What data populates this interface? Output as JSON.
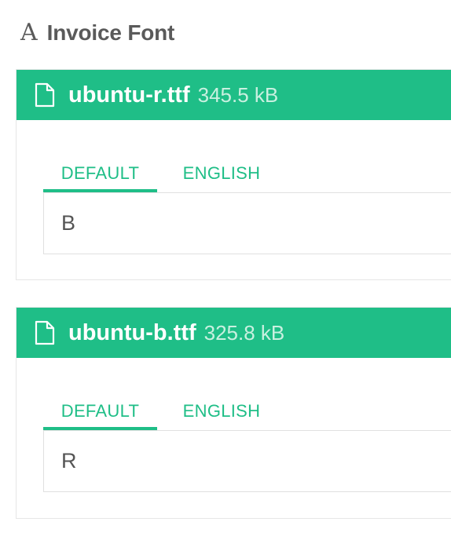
{
  "section": {
    "icon": "A",
    "title": "Invoice Font"
  },
  "files": [
    {
      "icon": "file-icon",
      "name": "ubuntu-r.ttf",
      "size": "345.5 kB",
      "tabs": [
        "DEFAULT",
        "ENGLISH"
      ],
      "active_tab": "DEFAULT",
      "value": "B"
    },
    {
      "icon": "file-icon",
      "name": "ubuntu-b.ttf",
      "size": "325.8 kB",
      "tabs": [
        "DEFAULT",
        "ENGLISH"
      ],
      "active_tab": "DEFAULT",
      "value": "R"
    }
  ],
  "colors": {
    "accent": "#1fbe87",
    "text": "#555555",
    "border": "#e0e0e0"
  }
}
